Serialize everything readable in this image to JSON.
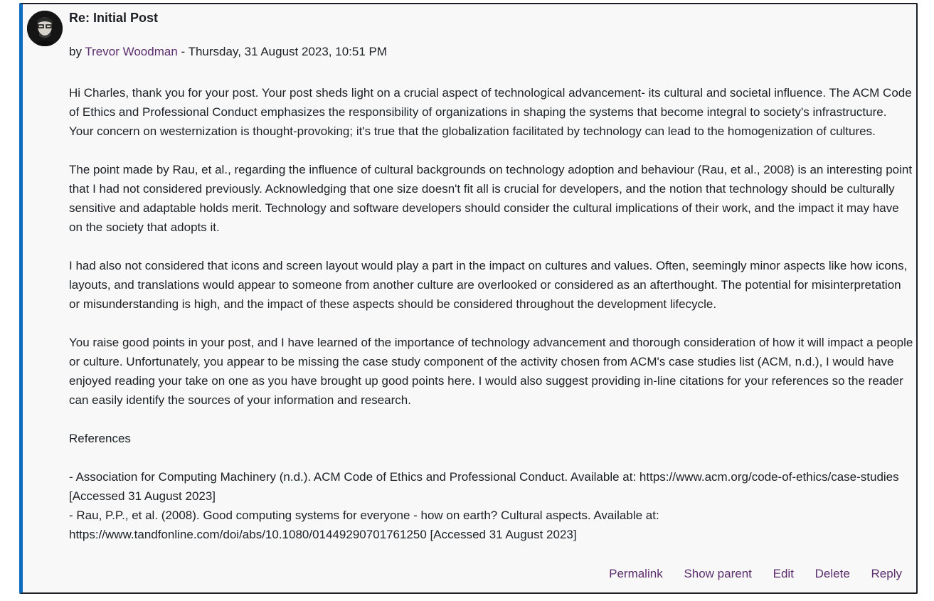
{
  "post": {
    "subject": "Re: Initial Post",
    "by_prefix": "by",
    "author": "Trevor Woodman",
    "date_separator": " - ",
    "date": "Thursday, 31 August 2023, 10:51 PM",
    "paragraphs": [
      "Hi Charles, thank you for your post. Your post sheds light on a crucial aspect of technological advancement- its cultural and societal influence. The ACM Code of Ethics and Professional Conduct emphasizes the responsibility of organizations in shaping the systems that become integral to society's infrastructure. Your concern on westernization is thought-provoking; it's true that the globalization facilitated by technology can lead to the homogenization of cultures.",
      "The point made by Rau, et al., regarding the influence of cultural backgrounds on technology adoption and behaviour (Rau, et al., 2008) is an interesting point that I had not considered previously. Acknowledging that one size doesn't fit all is crucial for developers, and the notion that technology should be culturally sensitive and adaptable holds merit. Technology and software developers should consider the cultural implications of their work, and the impact it may have on the society that adopts it.",
      "I had also not considered that icons and screen layout would play a part in the impact on cultures and values. Often, seemingly minor aspects like how icons, layouts, and translations would appear to someone from another culture are overlooked or considered as an afterthought. The potential for misinterpretation or misunderstanding is high, and the impact of these aspects should be considered throughout the development lifecycle.",
      "You raise good points in your post, and I have learned of the importance of technology advancement and thorough consideration of how it will impact a people or culture. Unfortunately, you appear to be missing the case study component of the activity chosen from ACM's case studies list (ACM, n.d.), I would have enjoyed reading your take on one as you have brought up good points here. I would also suggest providing in-line citations for your references so the reader can easily identify the sources of your information and research."
    ],
    "references_heading": "References",
    "references": [
      "- Association for Computing Machinery (n.d.). ACM Code of Ethics and Professional Conduct. Available at: https://www.acm.org/code-of-ethics/case-studies [Accessed 31 August 2023]",
      "- Rau, P.P., et al. (2008). Good computing systems for everyone - how on earth? Cultural aspects. Available at: https://www.tandfonline.com/doi/abs/10.1080/01449290701761250 [Accessed 31 August 2023]"
    ],
    "actions": {
      "permalink": "Permalink",
      "show_parent": "Show parent",
      "edit": "Edit",
      "delete": "Delete",
      "reply": "Reply"
    }
  },
  "colors": {
    "accent_border": "#0f6cbf",
    "link": "#5c2d6e",
    "text": "#1d2125",
    "background": "#f8f8f8"
  }
}
